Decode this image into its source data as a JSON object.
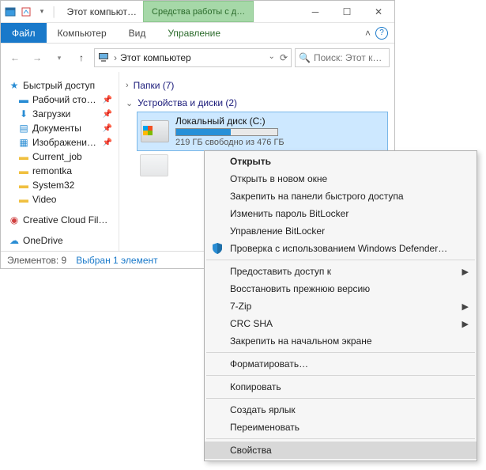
{
  "titlebar": {
    "title": "Этот компьют…",
    "extra_tab": "Средства работы с д…"
  },
  "ribbon": {
    "file": "Файл",
    "computer": "Компьютер",
    "view": "Вид",
    "manage": "Управление"
  },
  "address": {
    "location": "Этот компьютер"
  },
  "search": {
    "placeholder": "Поиск: Этот к…"
  },
  "sidebar": {
    "quick_access": "Быстрый доступ",
    "desktop": "Рабочий сто…",
    "downloads": "Загрузки",
    "documents": "Документы",
    "pictures": "Изображени…",
    "current_job": "Current_job",
    "remontka": "remontka",
    "system32": "System32",
    "video": "Video",
    "creative_cloud": "Creative Cloud Fil…",
    "onedrive": "OneDrive"
  },
  "content": {
    "folders_header": "Папки (7)",
    "drives_header": "Устройства и диски (2)",
    "drive_c": {
      "name": "Локальный диск (C:)",
      "free": "219 ГБ свободно из 476 ГБ",
      "fill_percent": 54
    }
  },
  "statusbar": {
    "elements": "Элементов: 9",
    "selected": "Выбран 1 элемент"
  },
  "context_menu": {
    "open": "Открыть",
    "open_new_window": "Открыть в новом окне",
    "pin_quick_access": "Закрепить на панели быстрого доступа",
    "change_bitlocker": "Изменить пароль BitLocker",
    "manage_bitlocker": "Управление BitLocker",
    "defender": "Проверка с использованием Windows Defender…",
    "give_access": "Предоставить доступ к",
    "restore_prev": "Восстановить прежнюю версию",
    "seven_zip": "7-Zip",
    "crc_sha": "CRC SHA",
    "pin_start": "Закрепить на начальном экране",
    "format": "Форматировать…",
    "copy": "Копировать",
    "create_shortcut": "Создать ярлык",
    "rename": "Переименовать",
    "properties": "Свойства"
  }
}
